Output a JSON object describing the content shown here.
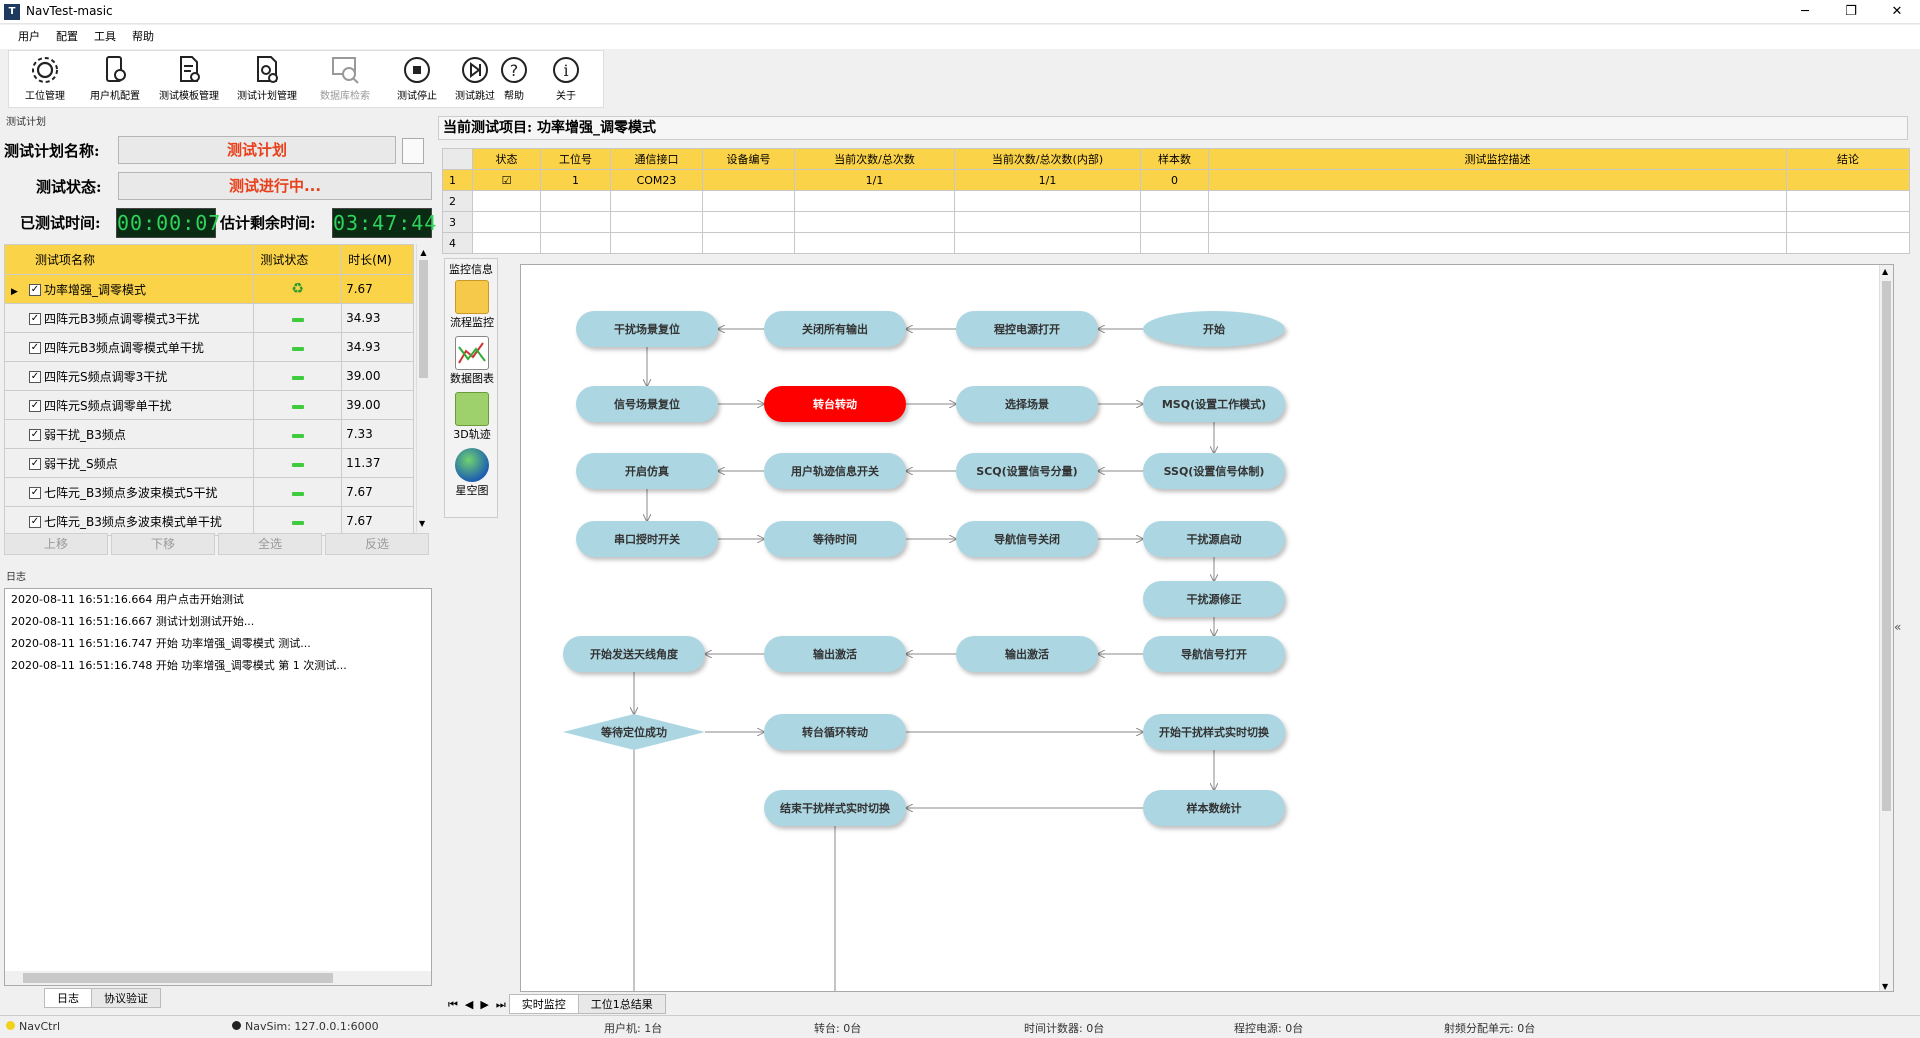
{
  "window": {
    "title": "NavTest-masic",
    "min": "─",
    "restore": "❐",
    "close": "✕"
  },
  "menu": [
    "用户",
    "配置",
    "工具",
    "帮助"
  ],
  "toolbar": [
    {
      "label": "工位管理",
      "icon": "gear-icon",
      "enabled": true
    },
    {
      "label": "用户机配置",
      "icon": "phone-gear-icon",
      "enabled": true
    },
    {
      "label": "测试模板管理",
      "icon": "doc-gear-icon",
      "enabled": true
    },
    {
      "label": "测试计划管理",
      "icon": "doc-settings-icon",
      "enabled": true
    },
    {
      "label": "数据库检索",
      "icon": "database-search-icon",
      "enabled": false
    },
    {
      "label": "测试停止",
      "icon": "stop-icon",
      "enabled": true
    },
    {
      "label": "测试跳过",
      "icon": "skip-icon",
      "enabled": true
    },
    {
      "label": "帮助",
      "icon": "help-icon",
      "enabled": true
    },
    {
      "label": "关于",
      "icon": "info-icon",
      "enabled": true
    }
  ],
  "plan": {
    "section_label": "测试计划",
    "name_label": "测试计划名称:",
    "name_value": "测试计划",
    "status_label": "测试状态:",
    "status_value": "测试进行中...",
    "elapsed_label": "已测试时间:",
    "elapsed_value": "00:00:07",
    "remaining_label": "估计剩余时间:",
    "remaining_value": "03:47:44",
    "columns": [
      "测试项名称",
      "测试状态",
      "时长(M)"
    ],
    "items": [
      {
        "name": "功率增强_调零模式",
        "duration": "7.67",
        "running": true
      },
      {
        "name": "四阵元B3频点调零模式3干扰",
        "duration": "34.93",
        "running": false
      },
      {
        "name": "四阵元B3频点调零模式单干扰",
        "duration": "34.93",
        "running": false
      },
      {
        "name": "四阵元S频点调零3干扰",
        "duration": "39.00",
        "running": false
      },
      {
        "name": "四阵元S频点调零单干扰",
        "duration": "39.00",
        "running": false
      },
      {
        "name": "弱干扰_B3频点",
        "duration": "7.33",
        "running": false
      },
      {
        "name": "弱干扰_S频点",
        "duration": "11.37",
        "running": false
      },
      {
        "name": "七阵元_B3频点多波束模式5干扰",
        "duration": "7.67",
        "running": false
      },
      {
        "name": "七阵元_B3频点多波束模式单干扰",
        "duration": "7.67",
        "running": false
      }
    ],
    "buttons": [
      "上移",
      "下移",
      "全选",
      "反选"
    ]
  },
  "log": {
    "label": "日志",
    "lines": [
      "2020-08-11 16:51:16.664 用户点击开始测试",
      "2020-08-11 16:51:16.667 测试计划测试开始...",
      "2020-08-11 16:51:16.747 开始 功率增强_调零模式 测试...",
      "2020-08-11 16:51:16.748 开始 功率增强_调零模式 第 1 次测试..."
    ],
    "tabs": [
      "日志",
      "协议验证"
    ]
  },
  "current": {
    "label": "当前测试项目:",
    "value": "功率增强_调零模式",
    "columns": [
      "状态",
      "工位号",
      "通信接口",
      "设备编号",
      "当前次数/总次数",
      "当前次数/总次数(内部)",
      "样本数",
      "测试监控描述",
      "结论"
    ],
    "rows": [
      {
        "n": "1",
        "checked": "☑",
        "station": "1",
        "port": "COM23",
        "device": "",
        "count": "1/1",
        "count_inner": "1/1",
        "samples": "0",
        "desc": "",
        "result": ""
      },
      {
        "n": "2",
        "checked": "",
        "station": "",
        "port": "",
        "device": "",
        "count": "",
        "count_inner": "",
        "samples": "",
        "desc": "",
        "result": ""
      },
      {
        "n": "3",
        "checked": "",
        "station": "",
        "port": "",
        "device": "",
        "count": "",
        "count_inner": "",
        "samples": "",
        "desc": "",
        "result": ""
      },
      {
        "n": "4",
        "checked": "",
        "station": "",
        "port": "",
        "device": "",
        "count": "",
        "count_inner": "",
        "samples": "",
        "desc": "",
        "result": ""
      }
    ]
  },
  "monitor": {
    "label": "监控信息",
    "items": [
      "流程监控",
      "数据图表",
      "3D轨迹",
      "星空图"
    ],
    "tabs": [
      "实时监控",
      "工位1总结果"
    ]
  },
  "flow": {
    "nodes": [
      {
        "id": "n1",
        "label": "干扰场景复位",
        "active": false
      },
      {
        "id": "n2",
        "label": "关闭所有输出",
        "active": false
      },
      {
        "id": "n3",
        "label": "程控电源打开",
        "active": false
      },
      {
        "id": "n4",
        "label": "开始",
        "active": false
      },
      {
        "id": "n5",
        "label": "信号场景复位",
        "active": false
      },
      {
        "id": "n6",
        "label": "转台转动",
        "active": true
      },
      {
        "id": "n7",
        "label": "选择场景",
        "active": false
      },
      {
        "id": "n8",
        "label": "MSQ(设置工作模式)",
        "active": false
      },
      {
        "id": "n9",
        "label": "开启仿真",
        "active": false
      },
      {
        "id": "n10",
        "label": "用户轨迹信息开关",
        "active": false
      },
      {
        "id": "n11",
        "label": "SCQ(设置信号分量)",
        "active": false
      },
      {
        "id": "n12",
        "label": "SSQ(设置信号体制)",
        "active": false
      },
      {
        "id": "n13",
        "label": "串口授时开关",
        "active": false
      },
      {
        "id": "n14",
        "label": "等待时间",
        "active": false
      },
      {
        "id": "n15",
        "label": "导航信号关闭",
        "active": false
      },
      {
        "id": "n16",
        "label": "干扰源启动",
        "active": false
      },
      {
        "id": "n17",
        "label": "干扰源修正",
        "active": false
      },
      {
        "id": "n18",
        "label": "开始发送天线角度",
        "active": false
      },
      {
        "id": "n19",
        "label": "输出激活",
        "active": false
      },
      {
        "id": "n20",
        "label": "输出激活",
        "active": false
      },
      {
        "id": "n21",
        "label": "导航信号打开",
        "active": false
      },
      {
        "id": "n22",
        "label": "等待定位成功",
        "active": false
      },
      {
        "id": "n23",
        "label": "转台循环转动",
        "active": false
      },
      {
        "id": "n24",
        "label": "开始干扰样式实时切换",
        "active": false
      },
      {
        "id": "n25",
        "label": "结束干扰样式实时切换",
        "active": false
      },
      {
        "id": "n26",
        "label": "样本数统计",
        "active": false
      }
    ]
  },
  "status": {
    "navctrl": "NavCtrl",
    "navsim": "NavSim:  127.0.0.1:6000",
    "user": "用户机:  1台",
    "turntable": "转台:  0台",
    "timer": "时间计数器:  0台",
    "power": "程控电源:  0台",
    "rf": "射频分配单元:  0台"
  },
  "colors": {
    "accent": "#fbd348",
    "active_node": "#ff0000",
    "node": "#acd6e2",
    "timer_text": "#2fd35a"
  }
}
